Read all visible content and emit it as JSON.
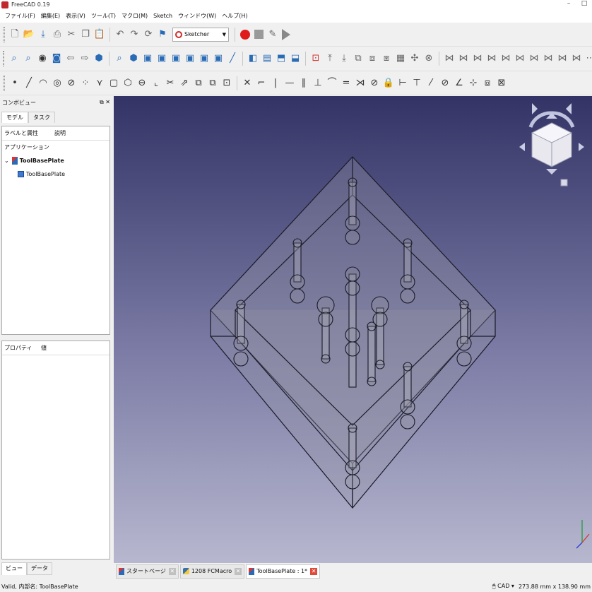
{
  "app": {
    "title": "FreeCAD 0.19"
  },
  "menu": [
    "ファイル(F)",
    "編集(E)",
    "表示(V)",
    "ツール(T)",
    "マクロ(M)",
    "Sketch",
    "ウィンドウ(W)",
    "ヘルプ(H)"
  ],
  "toolbar": {
    "workbench": "Sketcher"
  },
  "combo": {
    "title": "コンボビュー",
    "tabs": [
      "モデル",
      "タスク"
    ],
    "tree_headers": [
      "ラベルと属性",
      "説明"
    ],
    "tree": {
      "root": "アプリケーション",
      "document": "ToolBasePlate",
      "child": "ToolBasePlate"
    },
    "prop_headers": [
      "プロパティ",
      "値"
    ],
    "bottom_tabs": [
      "ビュー",
      "データ"
    ]
  },
  "doc_tabs": [
    {
      "label": "スタートページ"
    },
    {
      "label": "1208 FCMacro"
    },
    {
      "label": "ToolBasePlate : 1*"
    }
  ],
  "status": {
    "message": "Valid, 内部名: ToolBasePlate",
    "nav_style": "CAD",
    "dimensions": "273.88 mm x 138.90 mm"
  }
}
